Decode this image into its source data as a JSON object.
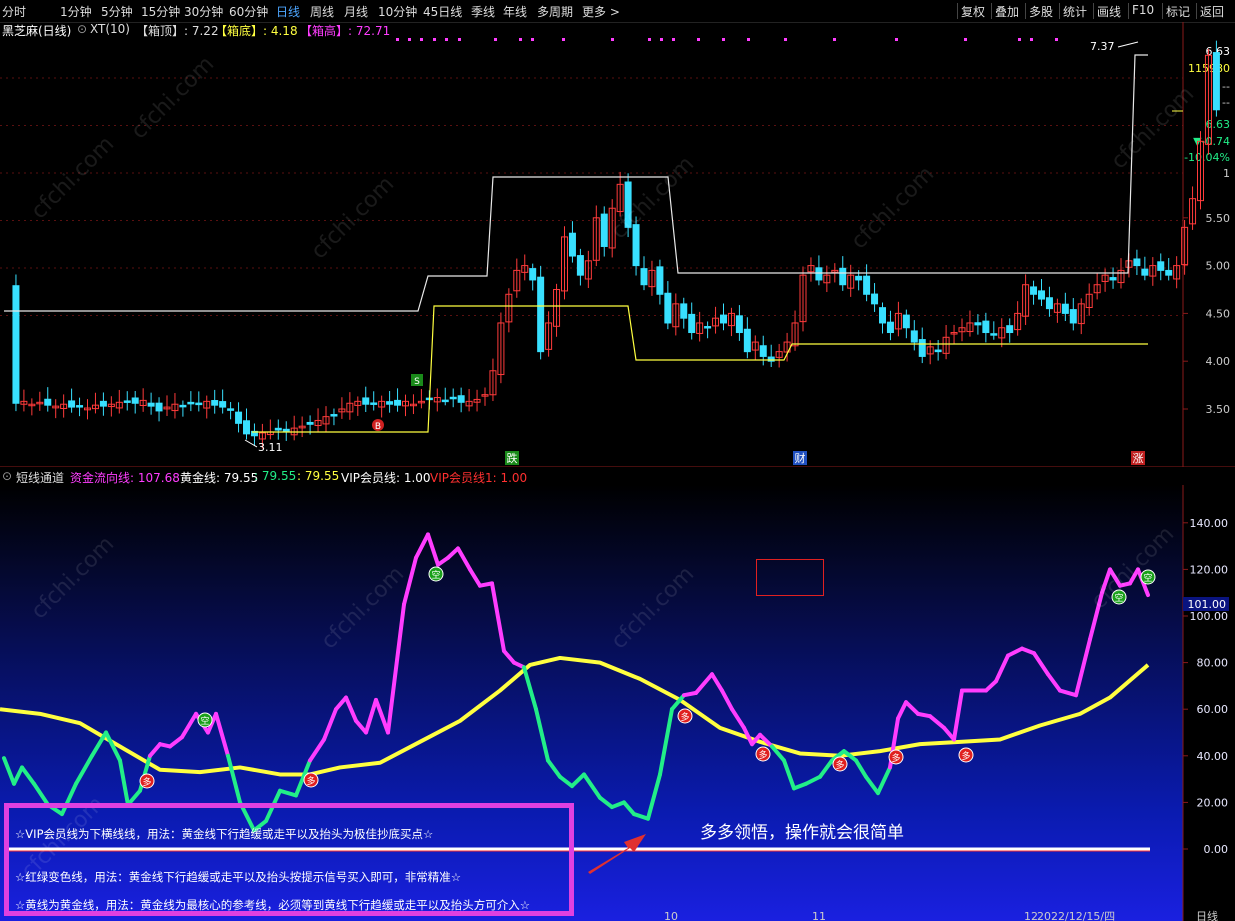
{
  "toolbar": {
    "periods": [
      "分时",
      "1分钟",
      "5分钟",
      "15分钟",
      "30分钟",
      "60分钟",
      "日线",
      "周线",
      "月线",
      "10分钟",
      "45日线",
      "季线",
      "年线",
      "多周期",
      "更多 >"
    ],
    "active_period": "日线",
    "right_buttons": [
      "复权",
      "叠加",
      "多股",
      "统计",
      "画线",
      "F10",
      "标记",
      "返回"
    ]
  },
  "chart_header": {
    "stock": "黑芝麻(日线)",
    "indicator": "XT(10)",
    "box_top_label": "【箱顶】: 7.22",
    "box_bottom_label": "【箱底】: 4.18",
    "box_height_label": "【箱高】: 72.71"
  },
  "price_axis": {
    "ticks": [
      "5.50",
      "5.00",
      "4.50",
      "4.00",
      "3.50"
    ],
    "info_panel": [
      "6.63",
      "115980",
      "--",
      "--",
      "6.63",
      "▼-0.74",
      "-10.04%",
      "1"
    ]
  },
  "annotations": {
    "high_label": "7.37",
    "low_label": "3.11",
    "buy_marker": "B",
    "sell_marker": "S",
    "event_markers": [
      "跌",
      "财",
      "涨"
    ]
  },
  "indicator": {
    "name": "短线通道",
    "legend": [
      {
        "label": "资金流向线: 107.68",
        "color": "#ff3dff"
      },
      {
        "label": "黄金线: 79.55",
        "color": "#ffffff"
      },
      {
        "label": ": 79.55",
        "color": "#22ee88"
      },
      {
        "label": ": 79.55",
        "color": "#ffff40"
      },
      {
        "label": "VIP会员线: 1.00",
        "color": "#ffffff"
      },
      {
        "label": "VIP会员线1: 1.00",
        "color": "#ff3030"
      }
    ],
    "y_ticks": [
      "140.00",
      "120.00",
      "100.00",
      "80.00",
      "60.00",
      "40.00",
      "20.00",
      "0.00"
    ],
    "current_value": "101.00",
    "duo_label": "多",
    "kong_label": "空"
  },
  "notes": [
    "☆VIP会员线为下横线线，用法：黄金线下行趋缓或走平以及抬头为极佳抄底买点☆",
    "☆红绿变色线，用法：黄金线下行趋缓或走平以及抬头按提示信号买入即可，非常精准☆",
    "☆黄线为黄金线，用法：黄金线为最核心的参考线，必须等到黄线下行趋缓或走平以及抬头方可介入☆"
  ],
  "callout": "多多领悟，操作就会很简单",
  "x_axis": {
    "labels": [
      "10",
      "11",
      "12",
      "2022/12/15/四"
    ],
    "corner_label": "日线"
  },
  "watermark": "cfchi.com",
  "colors": {
    "up": "#ff3b3b",
    "down": "#38e0ff",
    "money_flow": "#ff3dff",
    "green_line": "#22ee88",
    "golden": "#ffff40"
  }
}
